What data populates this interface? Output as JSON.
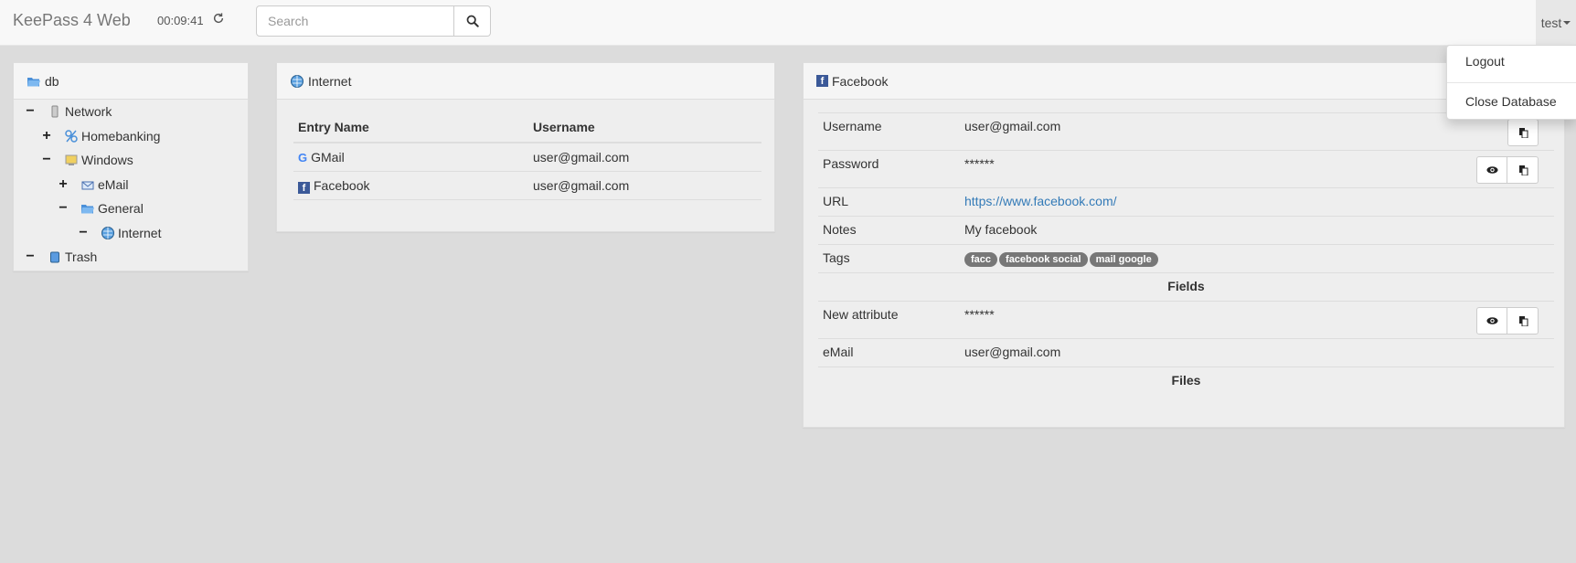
{
  "navbar": {
    "brand": "KeePass 4 Web",
    "timer": "00:09:41",
    "search_placeholder": "Search",
    "user": "test"
  },
  "dropdown": {
    "logout": "Logout",
    "close_db": "Close Database"
  },
  "tree": {
    "root": "db",
    "items": [
      {
        "label": "Network",
        "toggle": "−"
      },
      {
        "label": "Homebanking",
        "toggle": "+"
      },
      {
        "label": "Windows",
        "toggle": "−"
      },
      {
        "label": "eMail",
        "toggle": "+"
      },
      {
        "label": "General",
        "toggle": "−"
      },
      {
        "label": "Internet",
        "toggle": "−"
      },
      {
        "label": "Trash",
        "toggle": "−"
      }
    ]
  },
  "entries": {
    "title": "Internet",
    "col_name": "Entry Name",
    "col_user": "Username",
    "rows": [
      {
        "name": "GMail",
        "user": "user@gmail.com"
      },
      {
        "name": "Facebook",
        "user": "user@gmail.com"
      }
    ]
  },
  "detail": {
    "title": "Facebook",
    "username_label": "Username",
    "username": "user@gmail.com",
    "password_label": "Password",
    "password": "******",
    "url_label": "URL",
    "url": "https://www.facebook.com/",
    "notes_label": "Notes",
    "notes": "My facebook",
    "tags_label": "Tags",
    "tags": [
      "facc",
      "facebook social",
      "mail google"
    ],
    "fields_heading": "Fields",
    "new_attr_label": "New attribute",
    "new_attr": "******",
    "email_label": "eMail",
    "email": "user@gmail.com",
    "files_heading": "Files"
  },
  "colors": {
    "link": "#337ab7",
    "tag_bg": "#777777",
    "page_bg": "#dcdcdc"
  }
}
